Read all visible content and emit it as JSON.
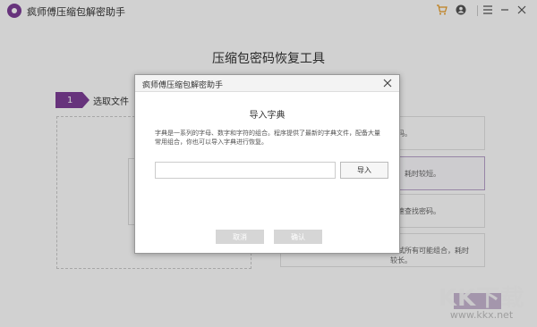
{
  "app": {
    "title": "疯师傅压缩包解密助手",
    "icons": [
      "cart-icon",
      "user-icon",
      "menu-icon",
      "minimize-icon",
      "close-icon"
    ]
  },
  "main": {
    "page_title": "压缩包密码恢复工具",
    "step": {
      "number": "1",
      "label": "选取文件"
    },
    "options": [
      {
        "text": "密码。"
      },
      {
        "text": "码，耗时较短。"
      },
      {
        "text": "快速查找密码。"
      },
      {
        "text": "会试所有可能组合，耗时较长。"
      }
    ]
  },
  "dialog": {
    "title": "疯师傅压缩包解密助手",
    "heading": "导入字典",
    "description": "字典是一系列的字母、数字和字符的组合。程序提供了最新的字典文件，配备大量常用组合，你也可以导入字典进行恢复。",
    "input_value": "",
    "import_label": "导入",
    "cancel_label": "取消",
    "ok_label": "确认"
  },
  "watermark": {
    "text": "KK下载",
    "url": "www.kkx.net"
  },
  "colors": {
    "accent": "#7e3f98"
  }
}
